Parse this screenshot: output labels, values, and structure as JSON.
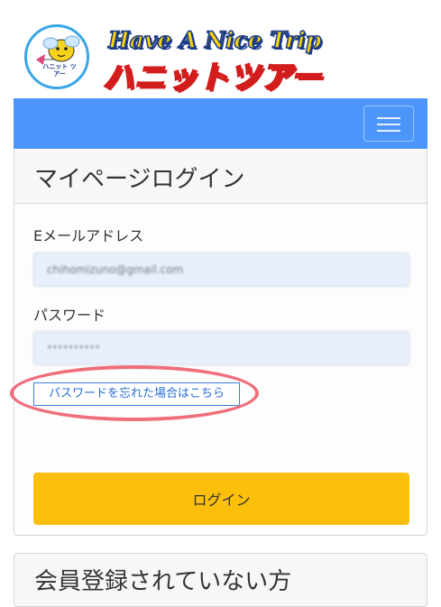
{
  "header": {
    "logo_en": "Have A Nice Trip",
    "logo_jp": "ハニットツアー",
    "badge_text": "ハニット ツアー"
  },
  "login_card": {
    "title": "マイページログイン",
    "email_label": "Eメールアドレス",
    "email_value": "chihomizuno@gmail.com",
    "password_label": "パスワード",
    "password_value": "••••••••••",
    "forgot_link": "パスワードを忘れた場合はこちら",
    "login_button": "ログイン"
  },
  "register_card": {
    "title": "会員登録されていない方"
  },
  "colors": {
    "navbar": "#4c95fb",
    "button": "#fcbf0c",
    "highlight": "#f06d7a",
    "field_bg": "#e8f0fe"
  }
}
